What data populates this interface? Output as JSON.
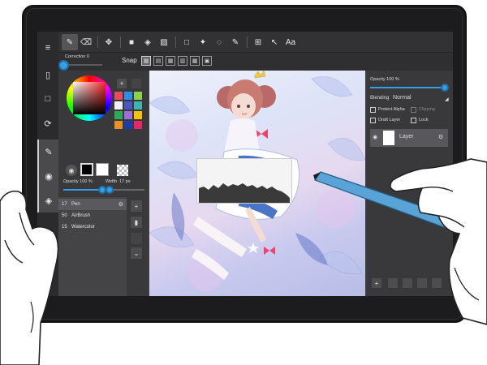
{
  "icons": {
    "menu": "≡",
    "pen": "✎",
    "eraser": "⌫",
    "move": "✥",
    "fill": "■",
    "bucket": "◈",
    "gradient": "▨",
    "select": "□",
    "magic": "✦",
    "lasso": "◌",
    "transform": "⊞",
    "cursor": "↖",
    "text": "Aa",
    "new": "▯",
    "rotate": "⟳",
    "brush": "✎",
    "palette": "◉",
    "layers": "◈",
    "redo": "↪",
    "undo": "↩",
    "plus": "+",
    "trash": "🗑",
    "down": "⌄",
    "gear": "⚙",
    "eye": "◉"
  },
  "snapbar": {
    "correction_label": "Correction 0",
    "snap_label": "Snap"
  },
  "colors": {
    "swatches": [
      "#e84a5f",
      "#2e8de8",
      "#8bd14a",
      "#f2f2f2",
      "#4a56c2",
      "#3cb4b0",
      "#2ea85a",
      "#9b6fd6",
      "#f5c400",
      "#e8902a",
      "#1a3ea8",
      "#e8246a"
    ],
    "accent": "#3a9de3"
  },
  "brush_settings": {
    "opacity_label": "Opacity 100 %",
    "opacity_value": 1.0,
    "width_label": "Width",
    "width_value": "17 px"
  },
  "brushes": [
    {
      "size": "17",
      "name": "Pen"
    },
    {
      "size": "50",
      "name": "AirBrush"
    },
    {
      "size": "15",
      "name": "Watercolor"
    }
  ],
  "layer_panel": {
    "opacity_label": "Opacity 100 %",
    "opacity_value": 1.0,
    "blending_label": "Blending",
    "blending_value": "Normal",
    "protect_alpha": "Protect Alpha",
    "clipping": "Clipping",
    "draft_layer": "Draft Layer",
    "lock": "Lock",
    "layer_name": "Layer"
  }
}
